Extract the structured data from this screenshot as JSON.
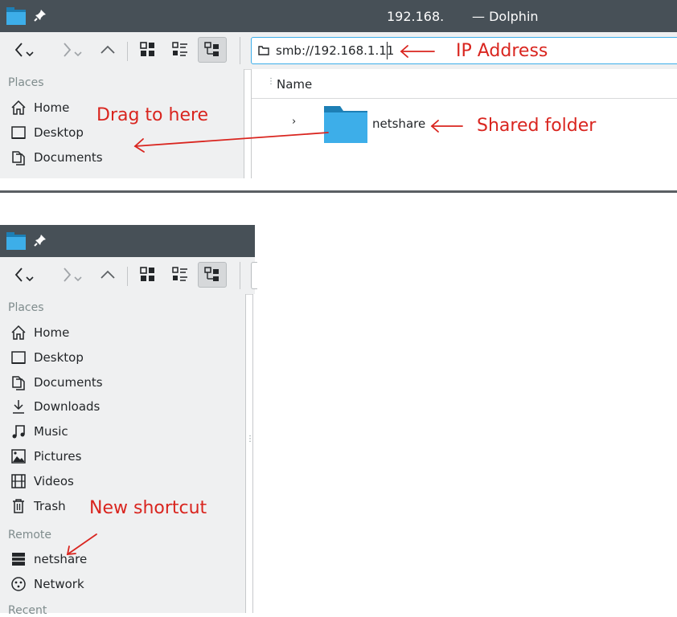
{
  "top_window": {
    "title": "192.168.",
    "app_suffix": "— Dolphin",
    "address": "smb://192.168.1.11",
    "column_header": "Name",
    "places_header": "Places",
    "places": [
      {
        "label": "Home",
        "icon": "home-icon"
      },
      {
        "label": "Desktop",
        "icon": "desktop-icon"
      },
      {
        "label": "Documents",
        "icon": "documents-icon"
      }
    ],
    "folder": {
      "name": "netshare",
      "icon": "folder-icon"
    }
  },
  "bottom_window": {
    "places_header": "Places",
    "places": [
      {
        "label": "Home",
        "icon": "home-icon"
      },
      {
        "label": "Desktop",
        "icon": "desktop-icon"
      },
      {
        "label": "Documents",
        "icon": "documents-icon"
      },
      {
        "label": "Downloads",
        "icon": "downloads-icon"
      },
      {
        "label": "Music",
        "icon": "music-icon"
      },
      {
        "label": "Pictures",
        "icon": "pictures-icon"
      },
      {
        "label": "Videos",
        "icon": "videos-icon"
      },
      {
        "label": "Trash",
        "icon": "trash-icon"
      }
    ],
    "remote_header": "Remote",
    "remote": [
      {
        "label": "netshare",
        "icon": "network-share-icon"
      },
      {
        "label": "Network",
        "icon": "network-icon"
      }
    ],
    "recent_header": "Recent"
  },
  "annotations": {
    "ip_address": "IP Address",
    "drag_to_here": "Drag to here",
    "shared_folder": "Shared folder",
    "new_shortcut": "New shortcut"
  },
  "colors": {
    "annotation": "#d9251f",
    "titlebar": "#475057",
    "folder": "#3daee9",
    "folder_dark": "#1d7fb5"
  }
}
